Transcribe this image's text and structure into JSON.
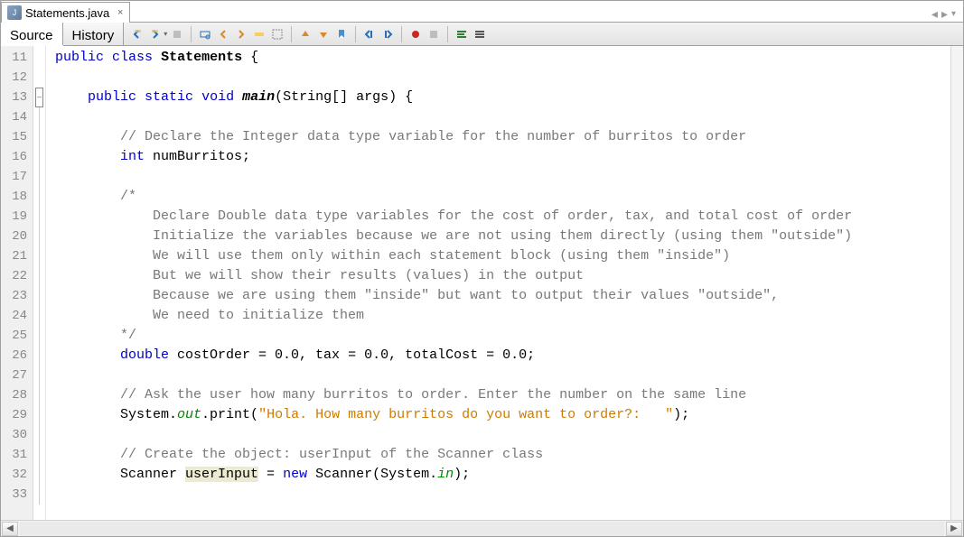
{
  "tab": {
    "filename": "Statements.java"
  },
  "views": {
    "source": "Source",
    "history": "History"
  },
  "lines": {
    "start": 11,
    "rows": [
      {
        "n": 11,
        "html": "<span class='kw'>public</span> <span class='kw'>class</span> <span class='bold'>Statements</span> {"
      },
      {
        "n": 12,
        "html": ""
      },
      {
        "n": 13,
        "html": "    <span class='kw'>public</span> <span class='kw'>static</span> <span class='kw'>void</span> <span class='bold italic'>main</span>(String[] args) {",
        "fold": "box"
      },
      {
        "n": 14,
        "html": ""
      },
      {
        "n": 15,
        "html": "        <span class='comment'>// Declare the Integer data type variable for the number of burritos to order</span>"
      },
      {
        "n": 16,
        "html": "        <span class='kw'>int</span> numBurritos;"
      },
      {
        "n": 17,
        "html": ""
      },
      {
        "n": 18,
        "html": "        <span class='comment'>/*</span>"
      },
      {
        "n": 19,
        "html": "<span class='comment'>            Declare Double data type variables for the cost of order, tax, and total cost of order</span>"
      },
      {
        "n": 20,
        "html": "<span class='comment'>            Initialize the variables because we are not using them directly (using them \"outside\")</span>"
      },
      {
        "n": 21,
        "html": "<span class='comment'>            We will use them only within each statement block (using them \"inside\")</span>"
      },
      {
        "n": 22,
        "html": "<span class='comment'>            But we will show their results (values) in the output</span>"
      },
      {
        "n": 23,
        "html": "<span class='comment'>            Because we are using them \"inside\" but want to output their values \"outside\",</span>"
      },
      {
        "n": 24,
        "html": "<span class='comment'>            We need to initialize them</span>"
      },
      {
        "n": 25,
        "html": "        <span class='comment'>*/</span>"
      },
      {
        "n": 26,
        "html": "        <span class='kw'>double</span> costOrder = 0.0, tax = 0.0, totalCost = 0.0;"
      },
      {
        "n": 27,
        "html": ""
      },
      {
        "n": 28,
        "html": "        <span class='comment'>// Ask the user how many burritos to order. Enter the number on the same line</span>"
      },
      {
        "n": 29,
        "html": "        System.<span class='static-ref'>out</span>.print(<span class='str'>\"Hola. How many burritos do you want to order?:   \"</span>);"
      },
      {
        "n": 30,
        "html": ""
      },
      {
        "n": 31,
        "html": "        <span class='comment'>// Create the object: userInput of the Scanner class</span>"
      },
      {
        "n": 32,
        "html": "        Scanner <span class='highlight-use'>userInput</span> = <span class='kw'>new</span> Scanner(System.<span class='static-ref'>in</span>);"
      },
      {
        "n": 33,
        "html": ""
      }
    ]
  }
}
